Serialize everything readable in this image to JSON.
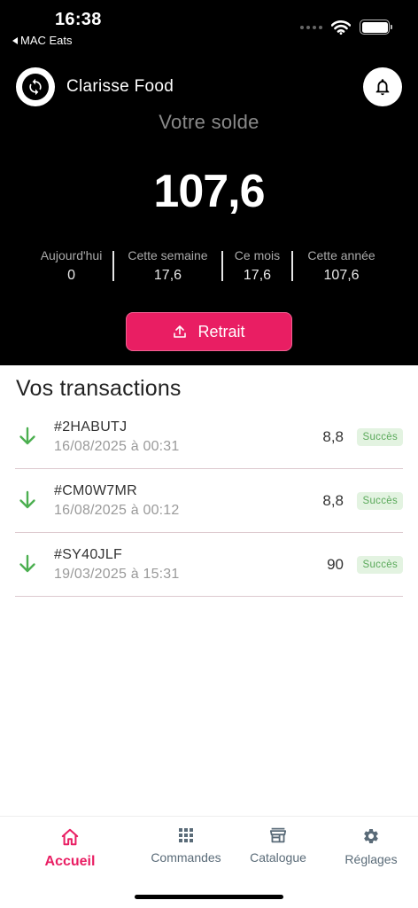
{
  "status_bar": {
    "time": "16:38",
    "back_app": "MAC Eats"
  },
  "header": {
    "store_name": "Clarisse Food",
    "balance_label": "Votre solde",
    "balance_value": "107,6",
    "stats": [
      {
        "label": "Aujourd'hui",
        "value": "0"
      },
      {
        "label": "Cette semaine",
        "value": "17,6"
      },
      {
        "label": "Ce mois",
        "value": "17,6"
      },
      {
        "label": "Cette année",
        "value": "107,6"
      }
    ],
    "withdraw_label": "Retrait"
  },
  "transactions": {
    "title": "Vos transactions",
    "items": [
      {
        "id": "#2HABUTJ",
        "date": "16/08/2025 à 00:31",
        "amount": "8,8",
        "status": "Succès"
      },
      {
        "id": "#CM0W7MR",
        "date": "16/08/2025 à 00:12",
        "amount": "8,8",
        "status": "Succès"
      },
      {
        "id": "#SY40JLF",
        "date": "19/03/2025 à 15:31",
        "amount": "90",
        "status": "Succès"
      }
    ]
  },
  "nav": {
    "home": "Accueil",
    "orders": "Commandes",
    "catalog": "Catalogue",
    "settings": "Réglages"
  },
  "colors": {
    "accent": "#e91e63",
    "success_text": "#5aa95a",
    "success_bg": "#e3f3e1",
    "incoming_arrow": "#4caf50",
    "nav_inactive": "#5a6b78"
  },
  "icons": {
    "sync": "sync-icon",
    "bell": "bell-icon",
    "upload": "upload-icon",
    "arrow_down": "arrow-down-icon",
    "home": "home-icon",
    "grid": "grid-icon",
    "store": "store-icon",
    "gear": "gear-icon"
  }
}
